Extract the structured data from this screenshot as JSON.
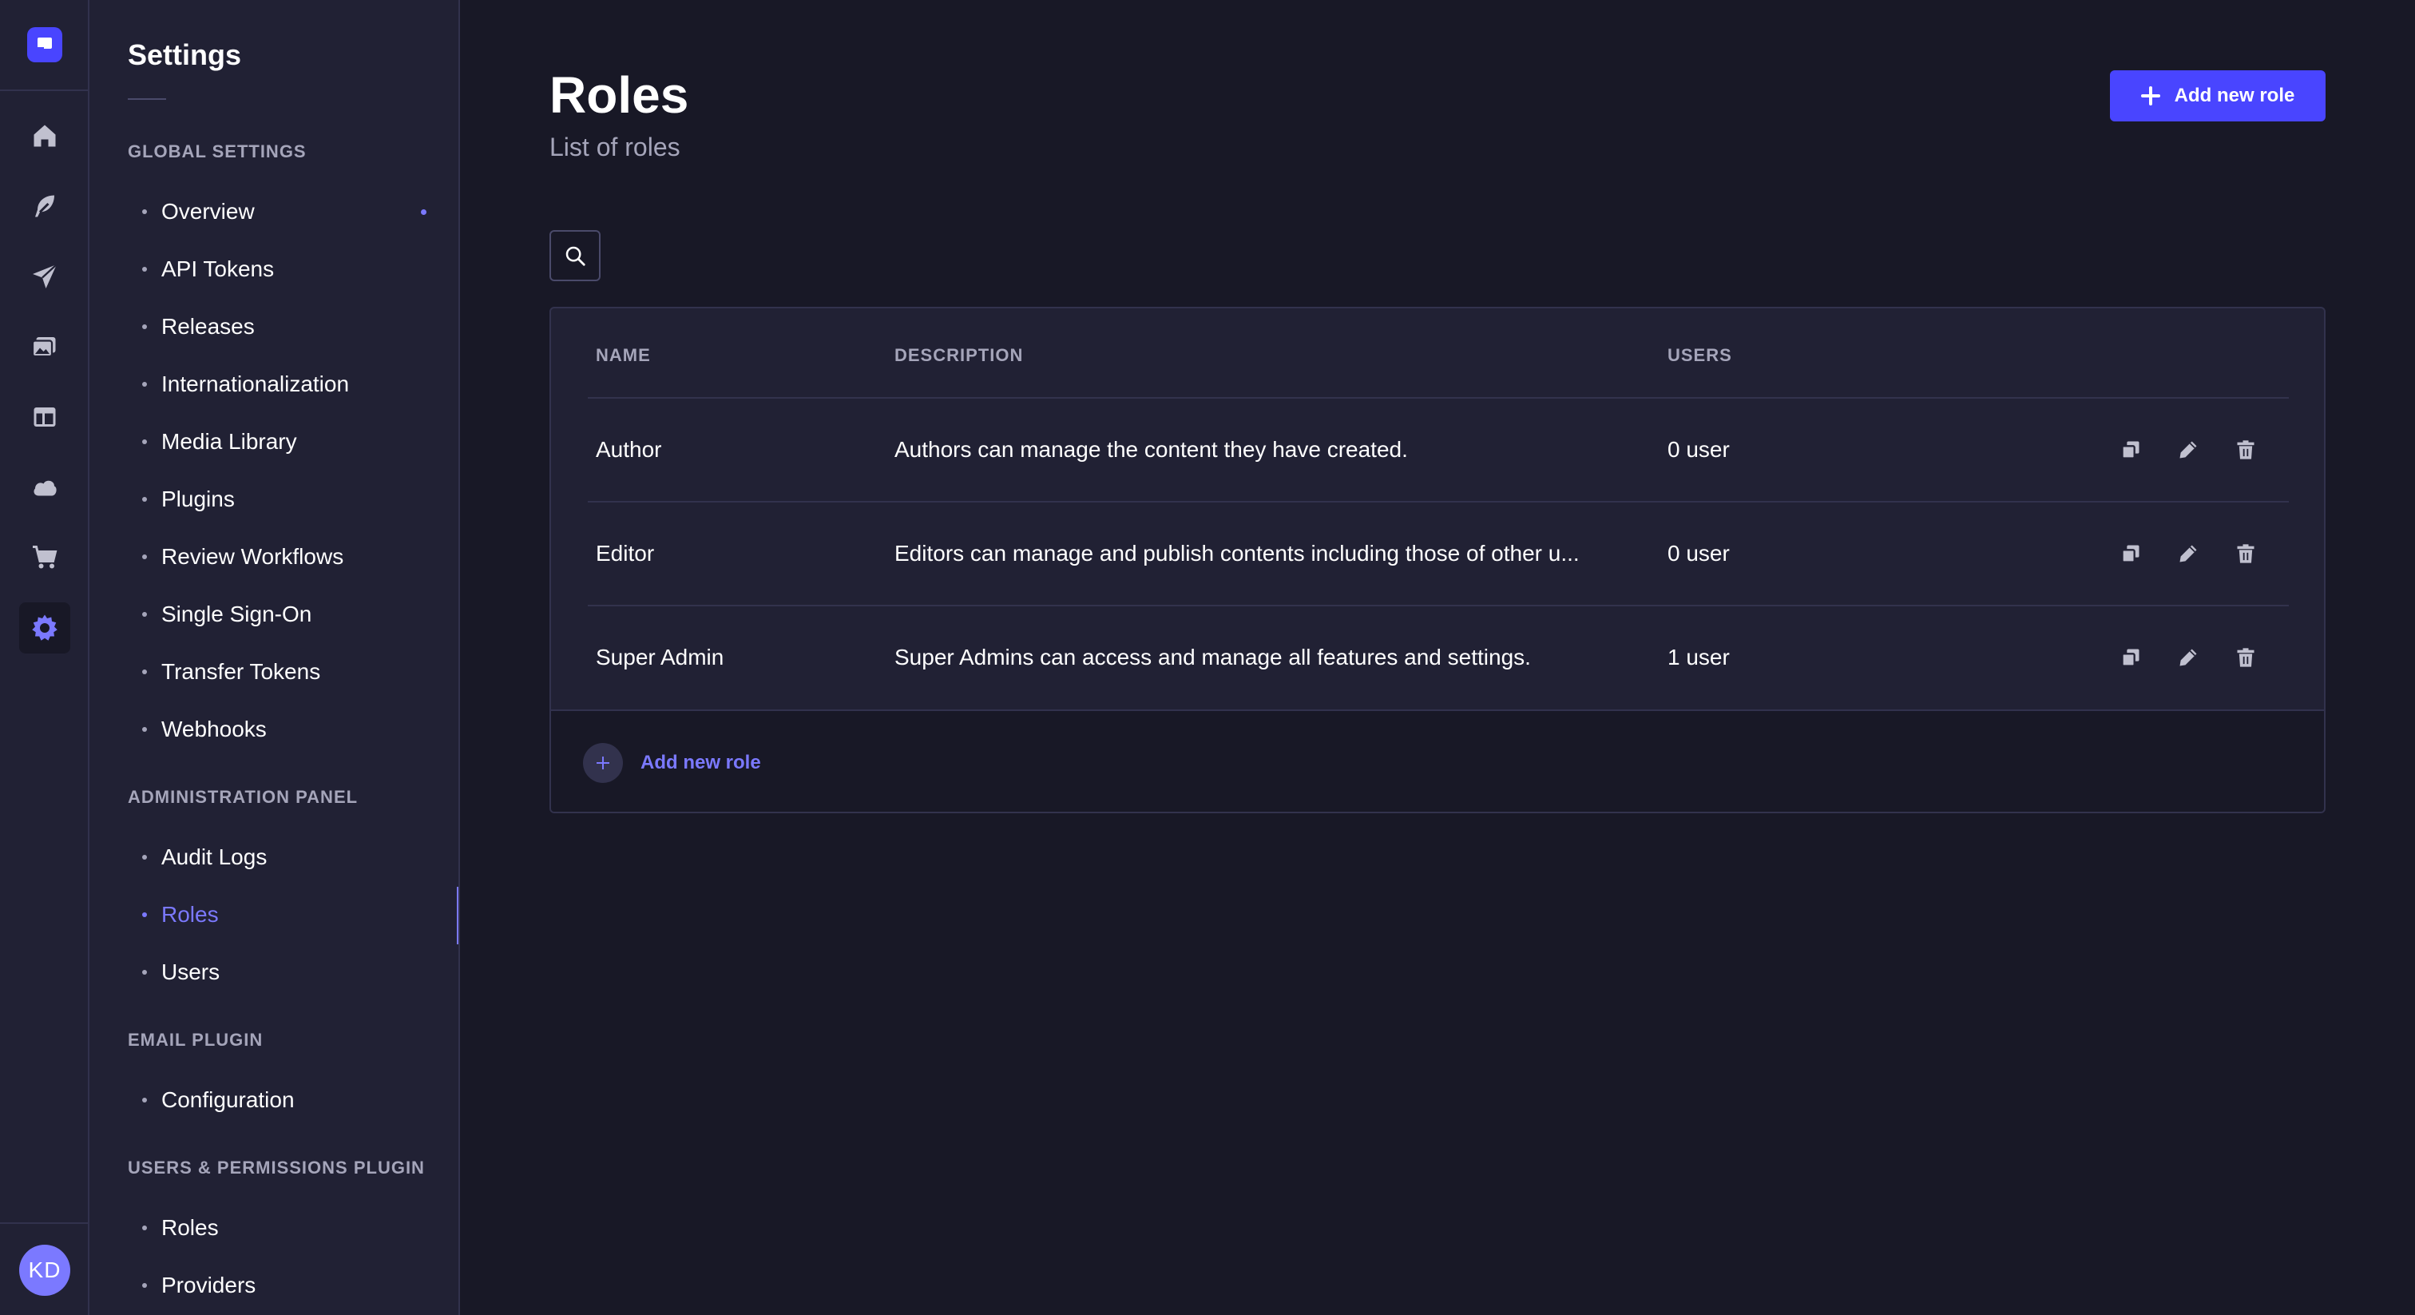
{
  "rail": {
    "logo_icon": "strapi-logo-icon",
    "items": [
      {
        "icon": "home-icon",
        "active": false
      },
      {
        "icon": "feather-icon",
        "active": false
      },
      {
        "icon": "paper-plane-icon",
        "active": false
      },
      {
        "icon": "media-images-icon",
        "active": false
      },
      {
        "icon": "layout-icon",
        "active": false
      },
      {
        "icon": "cloud-icon",
        "active": false
      },
      {
        "icon": "cart-icon",
        "active": false
      },
      {
        "icon": "gear-icon",
        "active": true
      }
    ],
    "avatar_initials": "KD"
  },
  "subnav": {
    "title": "Settings",
    "sections": [
      {
        "heading": "GLOBAL SETTINGS",
        "items": [
          {
            "label": "Overview",
            "active": false,
            "badge_dot": true
          },
          {
            "label": "API Tokens",
            "active": false
          },
          {
            "label": "Releases",
            "active": false
          },
          {
            "label": "Internationalization",
            "active": false
          },
          {
            "label": "Media Library",
            "active": false
          },
          {
            "label": "Plugins",
            "active": false
          },
          {
            "label": "Review Workflows",
            "active": false
          },
          {
            "label": "Single Sign-On",
            "active": false
          },
          {
            "label": "Transfer Tokens",
            "active": false
          },
          {
            "label": "Webhooks",
            "active": false
          }
        ]
      },
      {
        "heading": "ADMINISTRATION PANEL",
        "items": [
          {
            "label": "Audit Logs",
            "active": false
          },
          {
            "label": "Roles",
            "active": true
          },
          {
            "label": "Users",
            "active": false
          }
        ]
      },
      {
        "heading": "EMAIL PLUGIN",
        "items": [
          {
            "label": "Configuration",
            "active": false
          }
        ]
      },
      {
        "heading": "USERS & PERMISSIONS PLUGIN",
        "items": [
          {
            "label": "Roles",
            "active": false
          },
          {
            "label": "Providers",
            "active": false
          }
        ]
      }
    ]
  },
  "main": {
    "title": "Roles",
    "subtitle": "List of roles",
    "add_button_label": "Add new role",
    "search_icon": "search-icon",
    "table": {
      "columns": [
        "NAME",
        "DESCRIPTION",
        "USERS"
      ],
      "rows": [
        {
          "name": "Author",
          "description": "Authors can manage the content they have created.",
          "users": "0 user"
        },
        {
          "name": "Editor",
          "description": "Editors can manage and publish contents including those of other u...",
          "users": "0 user"
        },
        {
          "name": "Super Admin",
          "description": "Super Admins can access and manage all features and settings.",
          "users": "1 user"
        }
      ],
      "row_action_icons": [
        "duplicate-icon",
        "pencil-icon",
        "trash-icon"
      ],
      "footer_add_label": "Add new role"
    }
  },
  "colors": {
    "background": "#181826",
    "panel": "#212134",
    "border": "#32324d",
    "primary": "#4945ff",
    "accent": "#7b79ff",
    "muted_text": "#a5a5ba"
  }
}
